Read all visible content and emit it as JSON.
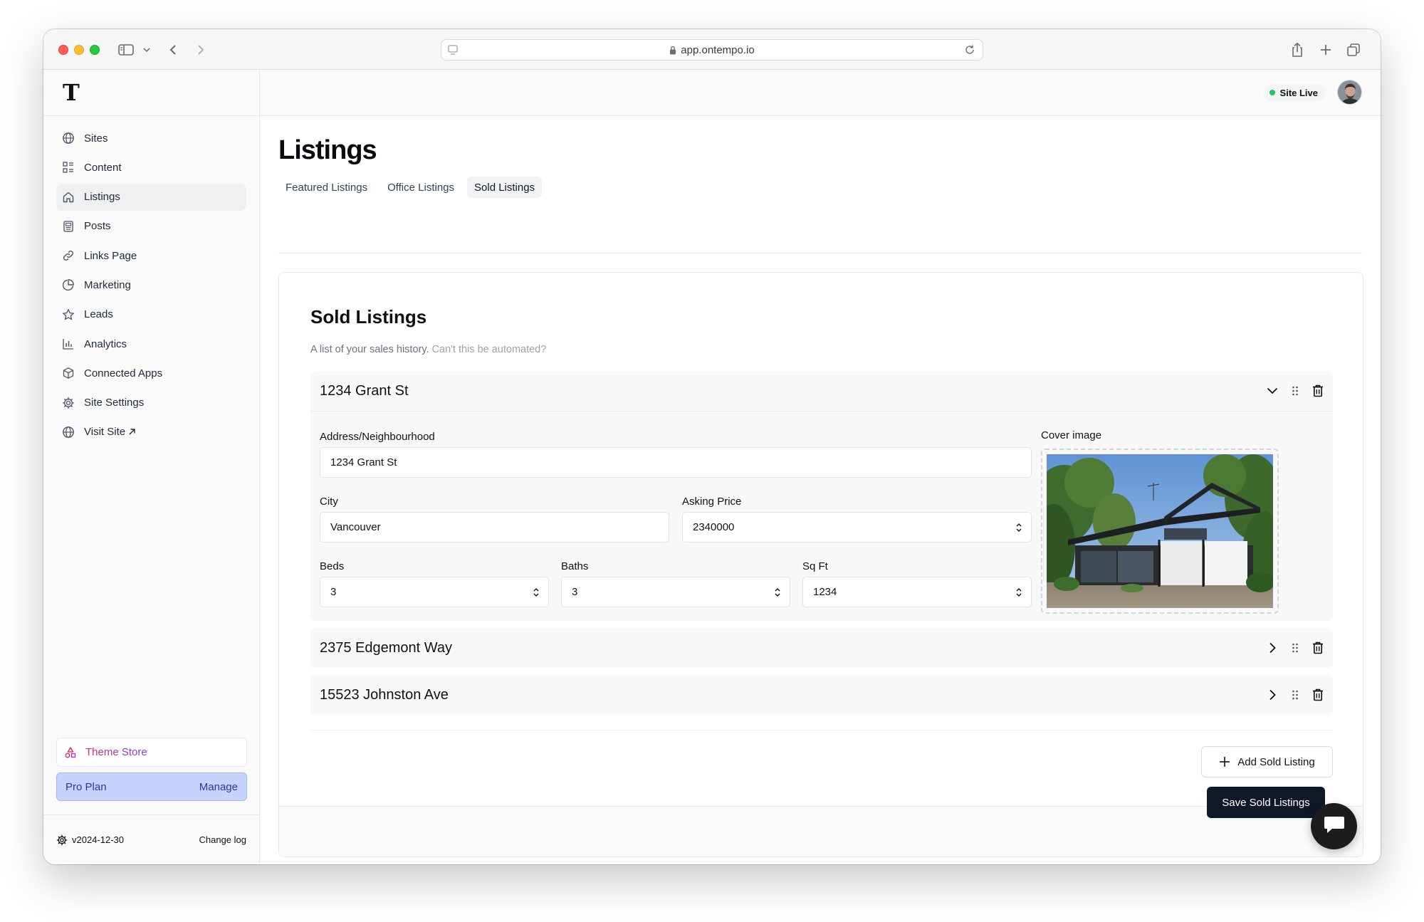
{
  "browser": {
    "url": "app.ontempo.io"
  },
  "brand": {
    "logo_letter": "T"
  },
  "sidebar": {
    "items": [
      {
        "label": "Sites",
        "icon": "globe-icon"
      },
      {
        "label": "Content",
        "icon": "layout-list-icon"
      },
      {
        "label": "Listings",
        "icon": "home-icon",
        "active": true
      },
      {
        "label": "Posts",
        "icon": "newspaper-icon"
      },
      {
        "label": "Links Page",
        "icon": "link-icon"
      },
      {
        "label": "Marketing",
        "icon": "pie-chart-icon"
      },
      {
        "label": "Leads",
        "icon": "star-icon"
      },
      {
        "label": "Analytics",
        "icon": "bar-chart-icon"
      },
      {
        "label": "Connected Apps",
        "icon": "box-icon"
      },
      {
        "label": "Site Settings",
        "icon": "gear-icon"
      },
      {
        "label": "Visit Site",
        "icon": "globe-icon",
        "external": true
      }
    ],
    "theme_store": "Theme Store",
    "plan": {
      "label": "Pro Plan",
      "action": "Manage"
    },
    "version": "v2024-12-30",
    "changelog": "Change log"
  },
  "header": {
    "status": "Site Live",
    "status_color": "#22c55e"
  },
  "page": {
    "title": "Listings",
    "tabs": [
      {
        "label": "Featured Listings",
        "active": false
      },
      {
        "label": "Office Listings",
        "active": false
      },
      {
        "label": "Sold Listings",
        "active": true
      }
    ]
  },
  "card": {
    "title": "Sold Listings",
    "description": "A list of your sales history.",
    "description_link": "Can't this be automated?",
    "listings": [
      {
        "title": "1234 Grant St",
        "expanded": true,
        "fields": {
          "address_label": "Address/Neighbourhood",
          "address_value": "1234 Grant St",
          "city_label": "City",
          "city_value": "Vancouver",
          "price_label": "Asking Price",
          "price_value": "2340000",
          "beds_label": "Beds",
          "beds_value": "3",
          "baths_label": "Baths",
          "baths_value": "3",
          "sqft_label": "Sq Ft",
          "sqft_value": "1234",
          "cover_label": "Cover image"
        }
      },
      {
        "title": "2375 Edgemont Way",
        "expanded": false
      },
      {
        "title": "15523 Johnston Ave",
        "expanded": false
      }
    ],
    "add_button": "Add Sold Listing",
    "save_button": "Save Sold Listings"
  },
  "colors": {
    "accent_dark": "#111827",
    "plan_bg": "#c7d2fe",
    "plan_text": "#3730a3"
  }
}
